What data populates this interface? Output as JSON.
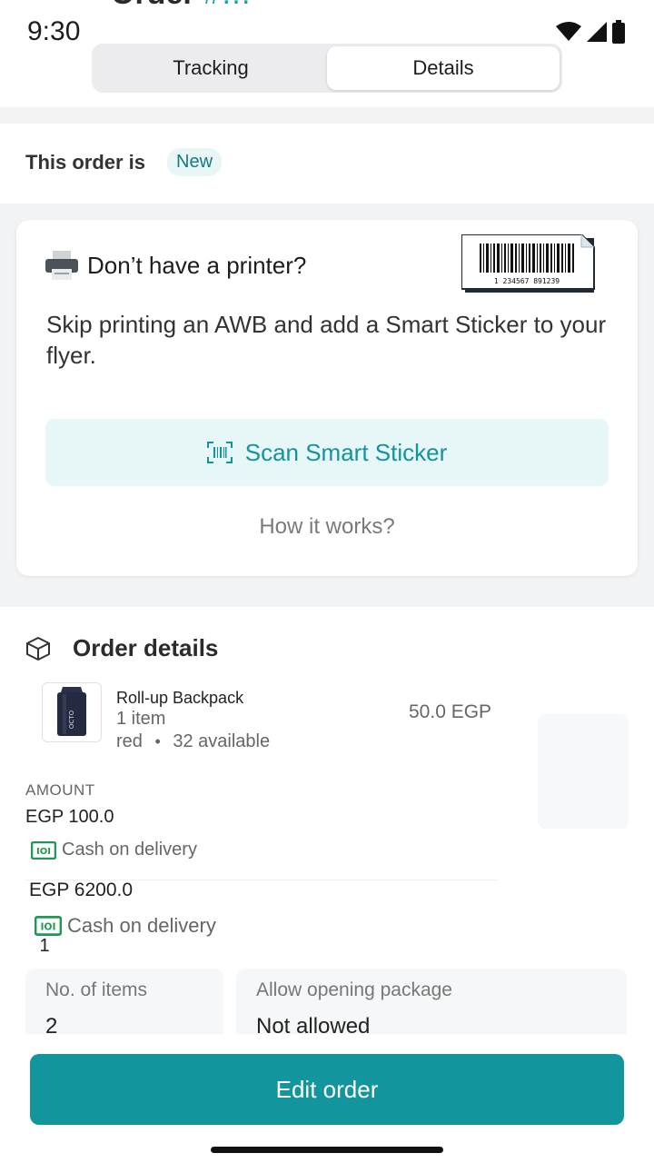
{
  "status_bar": {
    "time": "9:30",
    "icons": [
      "wifi-icon",
      "signal-icon",
      "battery-icon"
    ]
  },
  "header": {
    "title_partial": "Order",
    "order_partial": "#…"
  },
  "segmented": {
    "tabs": [
      {
        "label": "Tracking",
        "active": false
      },
      {
        "label": "Details",
        "active": true
      }
    ]
  },
  "order_status": {
    "label": "This order is",
    "badge": "New"
  },
  "printer_card": {
    "title": "Don’t have a printer?",
    "barcode_number": "1 234567 891239",
    "description": "Skip printing an AWB and add a Smart Sticker to your flyer.",
    "scan_button": "Scan Smart Sticker",
    "how_link": "How it works?"
  },
  "order_details": {
    "title": "Order details",
    "product": {
      "name": "Roll-up Backpack",
      "qty": "1 item",
      "color": "red",
      "dot": "•",
      "available": "32 available",
      "price": "50.0 EGP"
    },
    "amount_label": "AMOUNT",
    "amount_value": "EGP 100.0",
    "payment_method": "Cash on delivery",
    "amount_value_2": "EGP 6200.0",
    "payment_method_2": "Cash on delivery",
    "count_badge": "1",
    "stats": [
      {
        "label": "No. of items",
        "value": "2"
      },
      {
        "label": "Allow opening package",
        "value": "Not allowed"
      }
    ]
  },
  "actions": {
    "edit_order": "Edit order"
  },
  "colors": {
    "accent": "#12959d",
    "badge_bg": "#e8f6f6",
    "cash_green": "#1e9a52"
  }
}
